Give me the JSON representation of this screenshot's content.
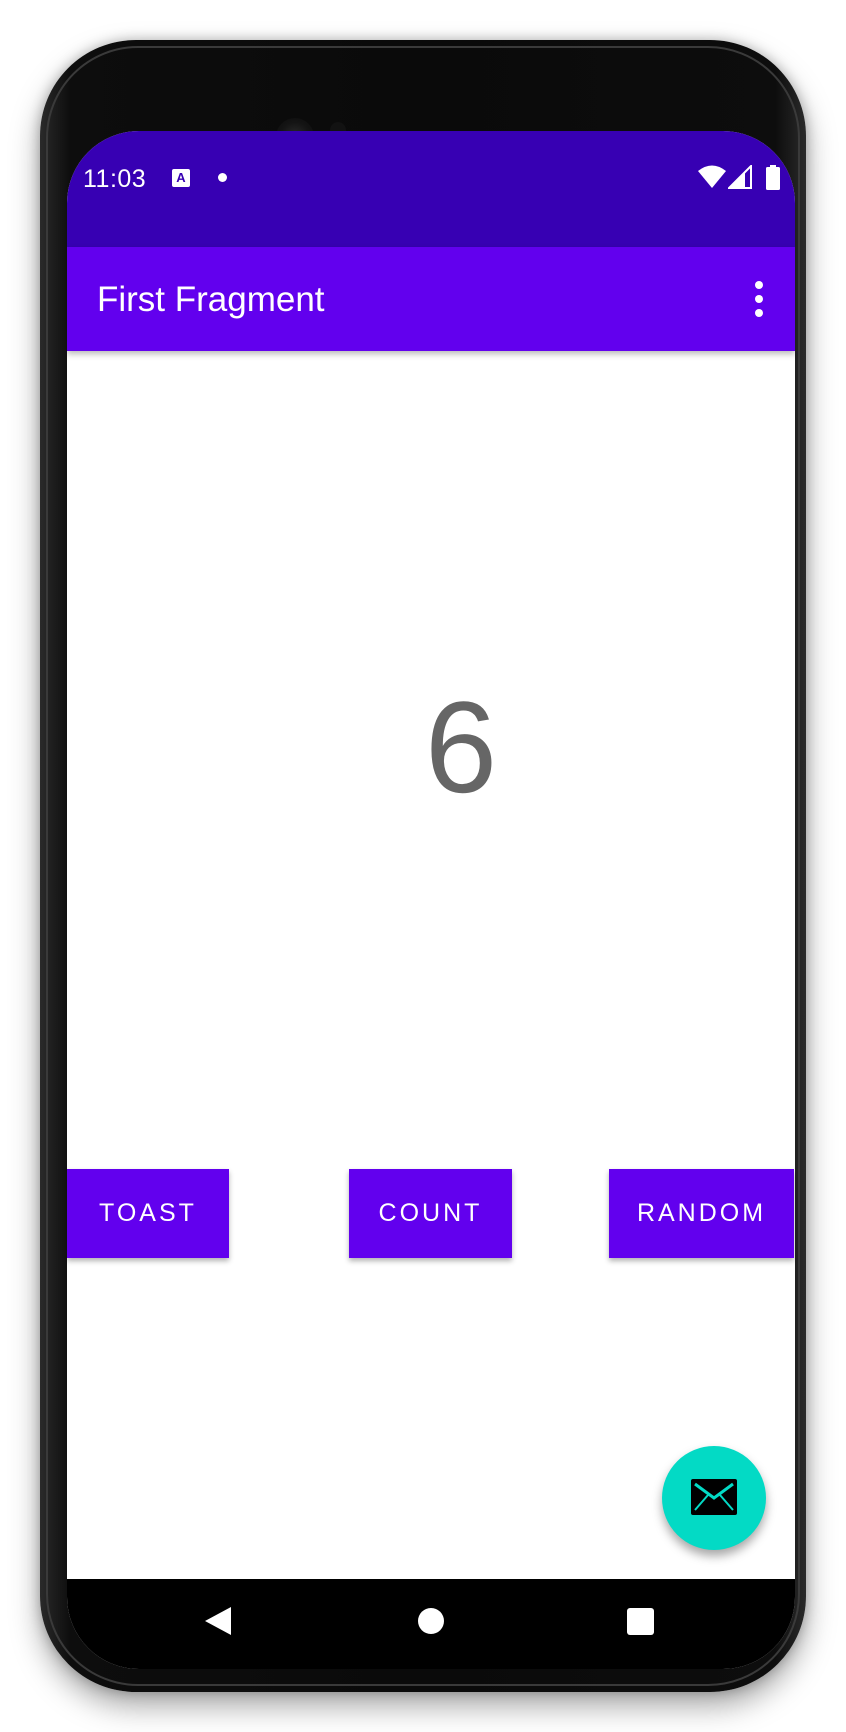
{
  "status_bar": {
    "time": "11:03",
    "notification_icon": "accessibility-a-icon",
    "icons": [
      "wifi-icon",
      "cell-signal-icon",
      "battery-icon"
    ]
  },
  "app_bar": {
    "title": "First Fragment",
    "menu_icon": "overflow-menu-icon"
  },
  "main": {
    "count_value": "6",
    "buttons": {
      "toast": "TOAST",
      "count": "COUNT",
      "random": "RANDOM"
    },
    "fab_icon": "email-icon"
  },
  "nav_bar": {
    "icons": [
      "back-icon",
      "home-icon",
      "recents-icon"
    ]
  },
  "colors": {
    "status_bar": "#3700b3",
    "primary": "#6200ee",
    "accent": "#03dac5",
    "count_text": "#666666"
  }
}
